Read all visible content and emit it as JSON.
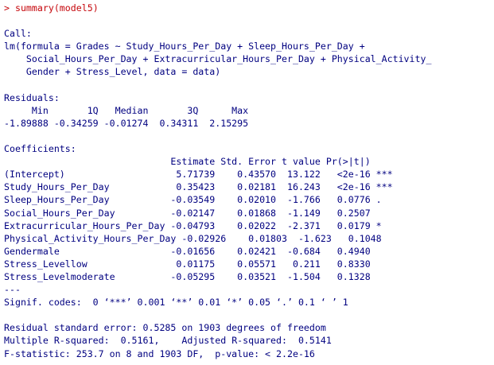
{
  "console": {
    "prompt_symbol": ">",
    "command": "summary(model5)",
    "call_header": "Call:",
    "call_lines": [
      "lm(formula = Grades ~ Study_Hours_Per_Day + Sleep_Hours_Per_Day +",
      "    Social_Hours_Per_Day + Extracurricular_Hours_Per_Day + Physical_Activity_",
      "    Gender + Stress_Level, data = data)"
    ],
    "residuals_header": "Residuals:",
    "residuals_labels": "     Min       1Q   Median       3Q      Max ",
    "residuals_values": "-1.89888 -0.34259 -0.01274  0.34311  2.15295 ",
    "coefficients_header": "Coefficients:",
    "coefficients_columns": "                              Estimate Std. Error t value Pr(>|t|)    ",
    "coefficients_rows": [
      "(Intercept)                    5.71739    0.43570  13.122   <2e-16 ***",
      "Study_Hours_Per_Day            0.35423    0.02181  16.243   <2e-16 ***",
      "Sleep_Hours_Per_Day           -0.03549    0.02010  -1.766   0.0776 .  ",
      "Social_Hours_Per_Day          -0.02147    0.01868  -1.149   0.2507    ",
      "Extracurricular_Hours_Per_Day -0.04793    0.02022  -2.371   0.0179 *  ",
      "Physical_Activity_Hours_Per_Day -0.02926    0.01803  -1.623   0.1048    ",
      "Gendermale                    -0.01656    0.02421  -0.684   0.4940    ",
      "Stress_Levellow                0.01175    0.05571   0.211   0.8330    ",
      "Stress_Levelmoderate          -0.05295    0.03521  -1.504   0.1328    "
    ],
    "separator": "---",
    "signif_codes": "Signif. codes:  0 ‘***’ 0.001 ‘**’ 0.01 ‘*’ 0.05 ‘.’ 0.1 ‘ ’ 1",
    "residual_se": "Residual standard error: 0.5285 on 1903 degrees of freedom",
    "r_squared": "Multiple R-squared:  0.5161,\tAdjusted R-squared:  0.5141 ",
    "f_statistic": "F-statistic: 253.7 on 8 and 1903 DF,  p-value: < 2.2e-16"
  }
}
